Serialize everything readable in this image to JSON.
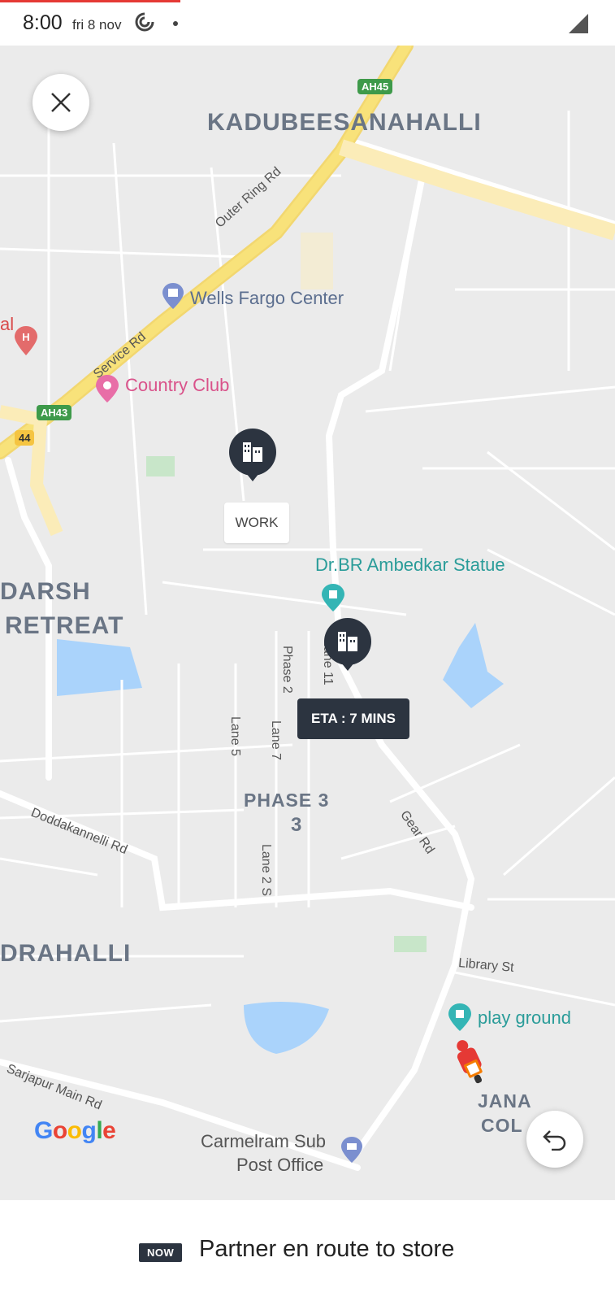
{
  "status_bar": {
    "time": "8:00",
    "date": "fri 8 nov",
    "icons": [
      "sync-icon",
      "notification-dot",
      "signal-icon"
    ]
  },
  "map": {
    "areas": {
      "kadubeesanahalli": "KADUBEESANAHALLI",
      "darsh": "DARSH",
      "retreat": "RETREAT",
      "phase3": "PHASE 3",
      "phase3_num": "3",
      "drahalli": "DRAHALLI",
      "jana": "JANA",
      "col": "COL"
    },
    "streets": {
      "outer_ring": "Outer Ring Rd",
      "service": "Service Rd",
      "doddakannelli": "Doddakannelli Rd",
      "gear": "Gear Rd",
      "library": "Library St",
      "sarjapur": "Sarjapur Main Rd",
      "phase2": "Phase 2",
      "lane11": "Lane 11",
      "lane5": "Lane 5",
      "lane7": "Lane 7",
      "lane2s": "Lane 2 S"
    },
    "pois": {
      "wells_fargo": "Wells Fargo Center",
      "country_club": "Country Club",
      "ambedkar": "Dr.BR Ambedkar Statue",
      "play_ground": "play ground",
      "carmelram_line1": "Carmelram Sub",
      "carmelram_line2": "Post Office",
      "hospital_partial": "al"
    },
    "shields": {
      "ah45": "AH45",
      "ah43": "AH43",
      "nh44": "44"
    },
    "markers": {
      "work_label": "WORK",
      "eta_label": "ETA : 7 MINS"
    },
    "attribution": [
      "G",
      "o",
      "o",
      "g",
      "l",
      "e"
    ]
  },
  "bottom": {
    "badge": "NOW",
    "status": "Partner en route to store"
  },
  "colors": {
    "marker": "#2c3440",
    "highway": "#f8e27a",
    "water": "#aad3fb",
    "park": "#c8e6c9",
    "accent_red": "#e53935"
  }
}
